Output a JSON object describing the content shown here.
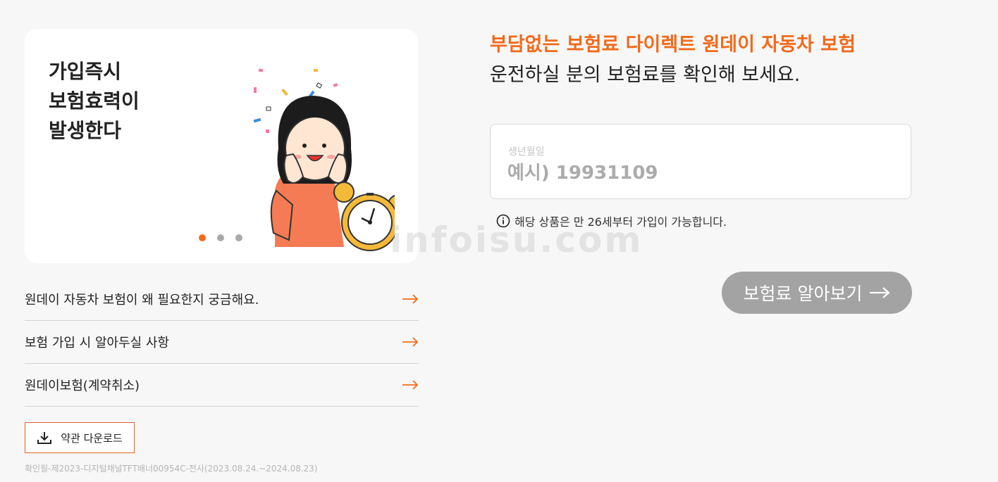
{
  "banner": {
    "title_lines": [
      "가입즉시",
      "보험효력이",
      "발생한다"
    ],
    "slide_count": 3,
    "active_slide": 1
  },
  "links": [
    {
      "label": "원데이 자동차 보험이 왜 필요한지 궁금해요."
    },
    {
      "label": "보험 가입 시 알아두실 사항"
    },
    {
      "label": "원데이보험(계약취소)"
    }
  ],
  "download": {
    "label": "약관 다운로드"
  },
  "footnote": "확인필-제2023-디지털채널TFT배너00954C-전사(2023.08.24.~2024.08.23)",
  "headline": {
    "line1": "부담없는 보험료 다이렉트 원데이 자동차 보험",
    "line2": "운전하실 분의 보험료를 확인해 보세요."
  },
  "birth_input": {
    "label": "생년월일",
    "value": "",
    "placeholder": "예시) 19931109"
  },
  "notice": "해당 상품은 만 26세부터 가입이 가능합니다.",
  "cta": {
    "label": "보험료 알아보기"
  },
  "watermark": "infoisu.com",
  "colors": {
    "accent": "#f26a1b",
    "cta_disabled": "#a3a3a3",
    "background": "#f7f7f7"
  }
}
